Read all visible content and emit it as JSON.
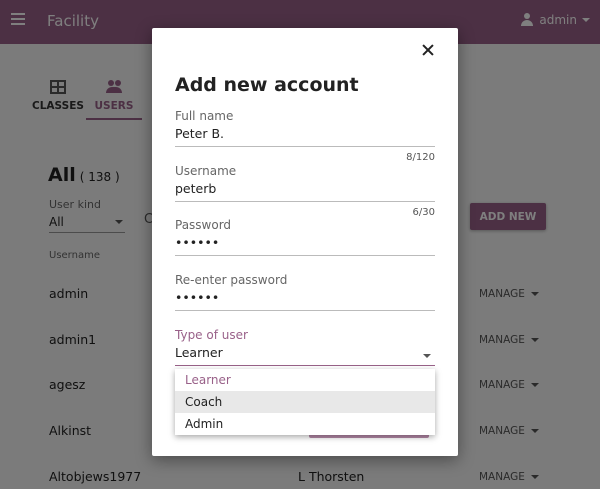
{
  "appbar": {
    "title": "Facility",
    "user": "admin"
  },
  "tabs": [
    {
      "label": "CLASSES"
    },
    {
      "label": "USERS"
    }
  ],
  "list": {
    "heading": "All",
    "count": "( 138 )",
    "user_kind_label": "User kind",
    "user_kind_value": "All",
    "search_fragment": "C",
    "add_new_label": "ADD NEW",
    "column_username": "Username",
    "manage_label": "MANAGE",
    "rows": [
      {
        "username": "admin",
        "full_name": ""
      },
      {
        "username": "admin1",
        "full_name": ""
      },
      {
        "username": "agesz",
        "full_name": ""
      },
      {
        "username": "Alkinst",
        "full_name": ""
      },
      {
        "username": "Altobjews1977",
        "full_name": "L Thorsten"
      }
    ]
  },
  "modal": {
    "title": "Add new account",
    "full_name": {
      "label": "Full name",
      "value": "Peter B.",
      "counter": "8/120"
    },
    "username": {
      "label": "Username",
      "value": "peterb",
      "counter": "6/30"
    },
    "password": {
      "label": "Password",
      "value": "••••••"
    },
    "reenter_password": {
      "label": "Re-enter password",
      "value": "••••••"
    },
    "type_of_user": {
      "label": "Type of user",
      "value": "Learner"
    },
    "type_options": [
      "Learner",
      "Coach",
      "Admin"
    ]
  },
  "colors": {
    "brand": "#996189",
    "overlay": "rgba(0,0,0,0.5)"
  }
}
